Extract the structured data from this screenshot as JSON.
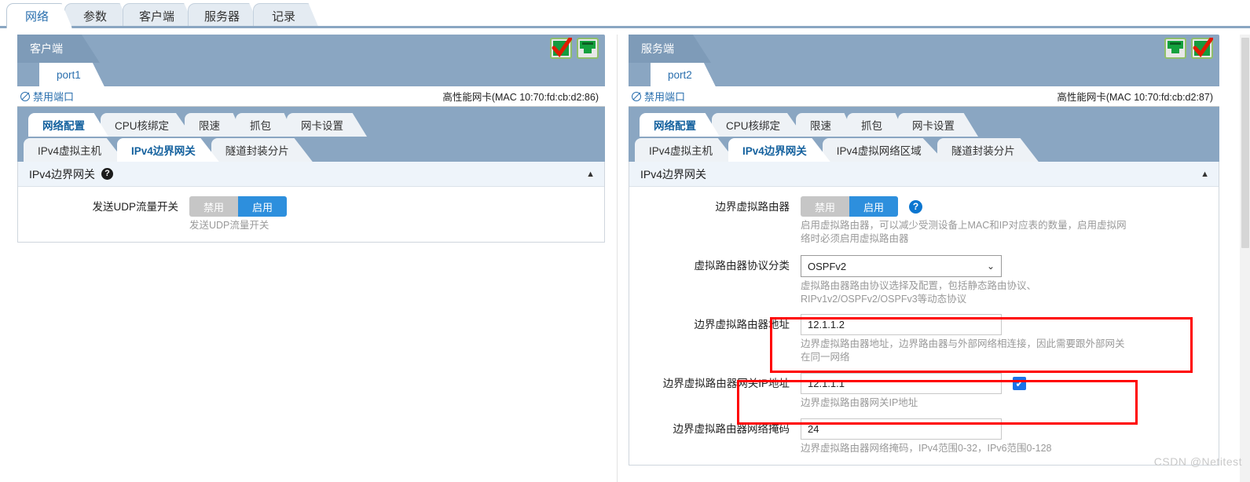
{
  "top_tabs": [
    {
      "label": "网络",
      "active": true
    },
    {
      "label": "参数",
      "active": false
    },
    {
      "label": "客户端",
      "active": false
    },
    {
      "label": "服务器",
      "active": false
    },
    {
      "label": "记录",
      "active": false
    }
  ],
  "left_panel": {
    "title": "客户端",
    "port_tab": "port1",
    "disable_port": "禁用端口",
    "nic_info": "高性能网卡(MAC 10:70:fd:cb:d2:86)",
    "tabs_row1": [
      {
        "label": "网络配置",
        "active": true
      },
      {
        "label": "CPU核绑定",
        "active": false
      },
      {
        "label": "限速",
        "active": false
      },
      {
        "label": "抓包",
        "active": false
      },
      {
        "label": "网卡设置",
        "active": false
      }
    ],
    "tabs_row2": [
      {
        "label": "IPv4虚拟主机",
        "active": false
      },
      {
        "label": "IPv4边界网关",
        "active": true
      },
      {
        "label": "隧道封装分片",
        "active": false
      }
    ],
    "card": {
      "title": "IPv4边界网关",
      "collapse_caret": "▲",
      "help_glyph": "?",
      "fields": [
        {
          "label": "发送UDP流量开关",
          "type": "toggle",
          "off_label": "禁用",
          "on_label": "启用",
          "value": "启用",
          "hint": "发送UDP流量开关"
        }
      ]
    },
    "status_icons": [
      "check-badge-icon",
      "ethernet-port-icon"
    ]
  },
  "right_panel": {
    "title": "服务端",
    "port_tab": "port2",
    "disable_port": "禁用端口",
    "nic_info": "高性能网卡(MAC 10:70:fd:cb:d2:87)",
    "tabs_row1": [
      {
        "label": "网络配置",
        "active": true
      },
      {
        "label": "CPU核绑定",
        "active": false
      },
      {
        "label": "限速",
        "active": false
      },
      {
        "label": "抓包",
        "active": false
      },
      {
        "label": "网卡设置",
        "active": false
      }
    ],
    "tabs_row2": [
      {
        "label": "IPv4虚拟主机",
        "active": false
      },
      {
        "label": "IPv4边界网关",
        "active": true
      },
      {
        "label": "IPv4虚拟网络区域",
        "active": false
      },
      {
        "label": "隧道封装分片",
        "active": false
      }
    ],
    "card": {
      "title": "IPv4边界网关",
      "collapse_caret": "▲",
      "fields": {
        "vrouter_toggle": {
          "label": "边界虚拟路由器",
          "off_label": "禁用",
          "on_label": "启用",
          "value": "启用",
          "help_glyph": "?",
          "hint": "启用虚拟路由器，可以减少受测设备上MAC和IP对应表的数量，启用虚拟网络时必须启用虚拟路由器"
        },
        "protocol": {
          "label": "虚拟路由器协议分类",
          "value": "OSPFv2",
          "chevron": "⌄",
          "hint": "虚拟路由器路由协议选择及配置，包括静态路由协议、RIPv1v2/OSPFv2/OSPFv3等动态协议"
        },
        "vrouter_address": {
          "label": "边界虚拟路由器地址",
          "value": "12.1.1.2",
          "hint": "边界虚拟路由器地址，边界路由器与外部网络相连接，因此需要跟外部网关在同一网络",
          "highlighted": true
        },
        "gateway_ip": {
          "label": "边界虚拟路由器网关IP地址",
          "value": "12.1.1.1",
          "checkbox_checked": true,
          "checkbox_glyph": "✔",
          "hint": "边界虚拟路由器网关IP地址",
          "highlighted": true
        },
        "netmask": {
          "label": "边界虚拟路由器网络掩码",
          "value": "24",
          "hint": "边界虚拟路由器网络掩码，IPv4范围0-32，IPv6范围0-128"
        }
      }
    },
    "status_icons": [
      "ethernet-port-icon",
      "check-badge-icon"
    ]
  },
  "watermark": "CSDN @Netitest",
  "colors": {
    "accent_blue": "#2d8fdd",
    "panel_header": "#8aa6c2",
    "tab_active_text": "#14619e",
    "highlight_red": "#ff0000",
    "toggle_off_gray": "#c6c6c6"
  }
}
